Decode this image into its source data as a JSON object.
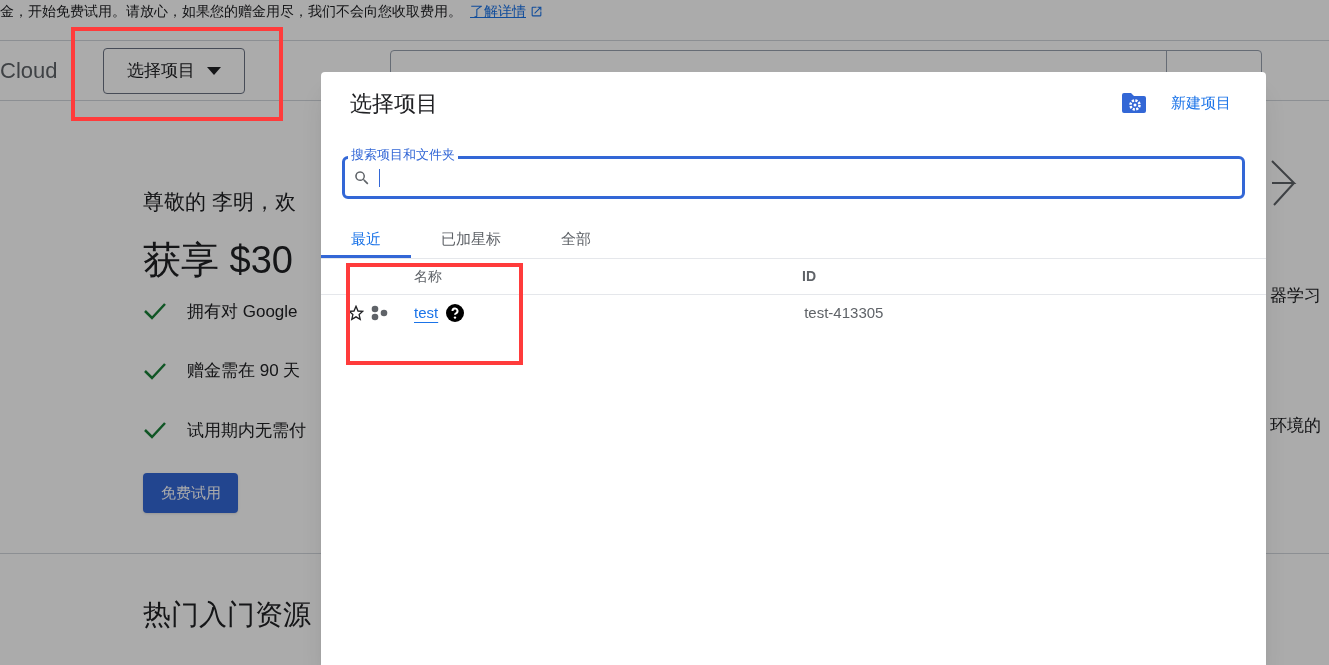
{
  "banner": {
    "text": "金，开始免费试用。请放心，如果您的赠金用尽，我们不会向您收取费用。",
    "link": "了解详情"
  },
  "header": {
    "product": "Cloud",
    "project_button": "选择项目"
  },
  "welcome": {
    "greeting": "尊敬的 李明，欢",
    "headline": "获享 $30",
    "benefits": [
      "拥有对 Google",
      "赠金需在 90 天",
      "试用期内无需付"
    ],
    "trial_button": "免费试用"
  },
  "side_texts": [
    "器学习",
    "环境的"
  ],
  "resources_heading": "热门入门资源",
  "dialog": {
    "title": "选择项目",
    "new_project": "新建项目",
    "search": {
      "label": "搜索项目和文件夹"
    },
    "tabs": [
      {
        "label": "最近",
        "selected": true
      },
      {
        "label": "已加星标",
        "selected": false
      },
      {
        "label": "全部",
        "selected": false
      }
    ],
    "columns": [
      "名称",
      "ID"
    ],
    "rows": [
      {
        "starred": false,
        "name": "test",
        "id": "test-413305"
      }
    ]
  }
}
